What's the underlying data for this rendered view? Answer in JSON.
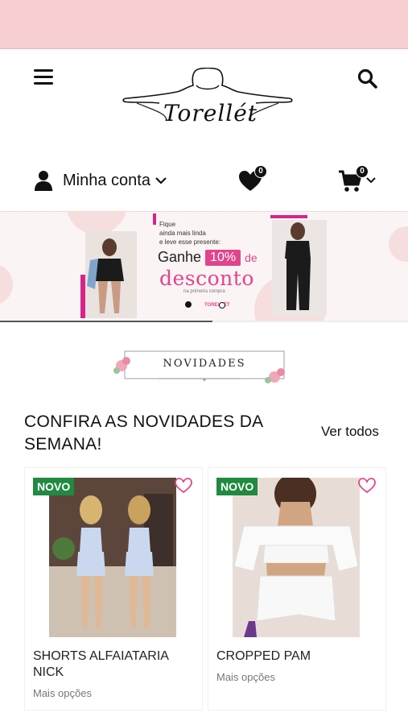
{
  "header": {
    "menu_icon": "hamburger-icon",
    "search_icon": "search-icon",
    "logo_text": "Torellét",
    "account_label": "Minha conta",
    "wishlist_count": "0",
    "cart_count": "0"
  },
  "banner": {
    "line1": "Fique",
    "line2": "ainda mais linda",
    "line3": "e leve esse presente:",
    "ganhe": "Ganhe",
    "percent": "10%",
    "de": "de",
    "desconto": "desconto",
    "primeira": "na primeira compra",
    "brand": "TORELLÉT",
    "progress": 0.52
  },
  "novidades_badge": "NOVIDADES",
  "section": {
    "title": "CONFIRA AS NOVIDADES DA SEMANA!",
    "see_all": "Ver todos"
  },
  "products": [
    {
      "badge": "NOVO",
      "name": "SHORTS ALFAIATARIA NICK",
      "options": "Mais opções"
    },
    {
      "badge": "NOVO",
      "name": "CROPPED PAM",
      "options": "Mais opções"
    }
  ],
  "colors": {
    "topbar": "#f7cfd2",
    "accent_pink": "#e0458b",
    "new_badge": "#1f8a40"
  }
}
